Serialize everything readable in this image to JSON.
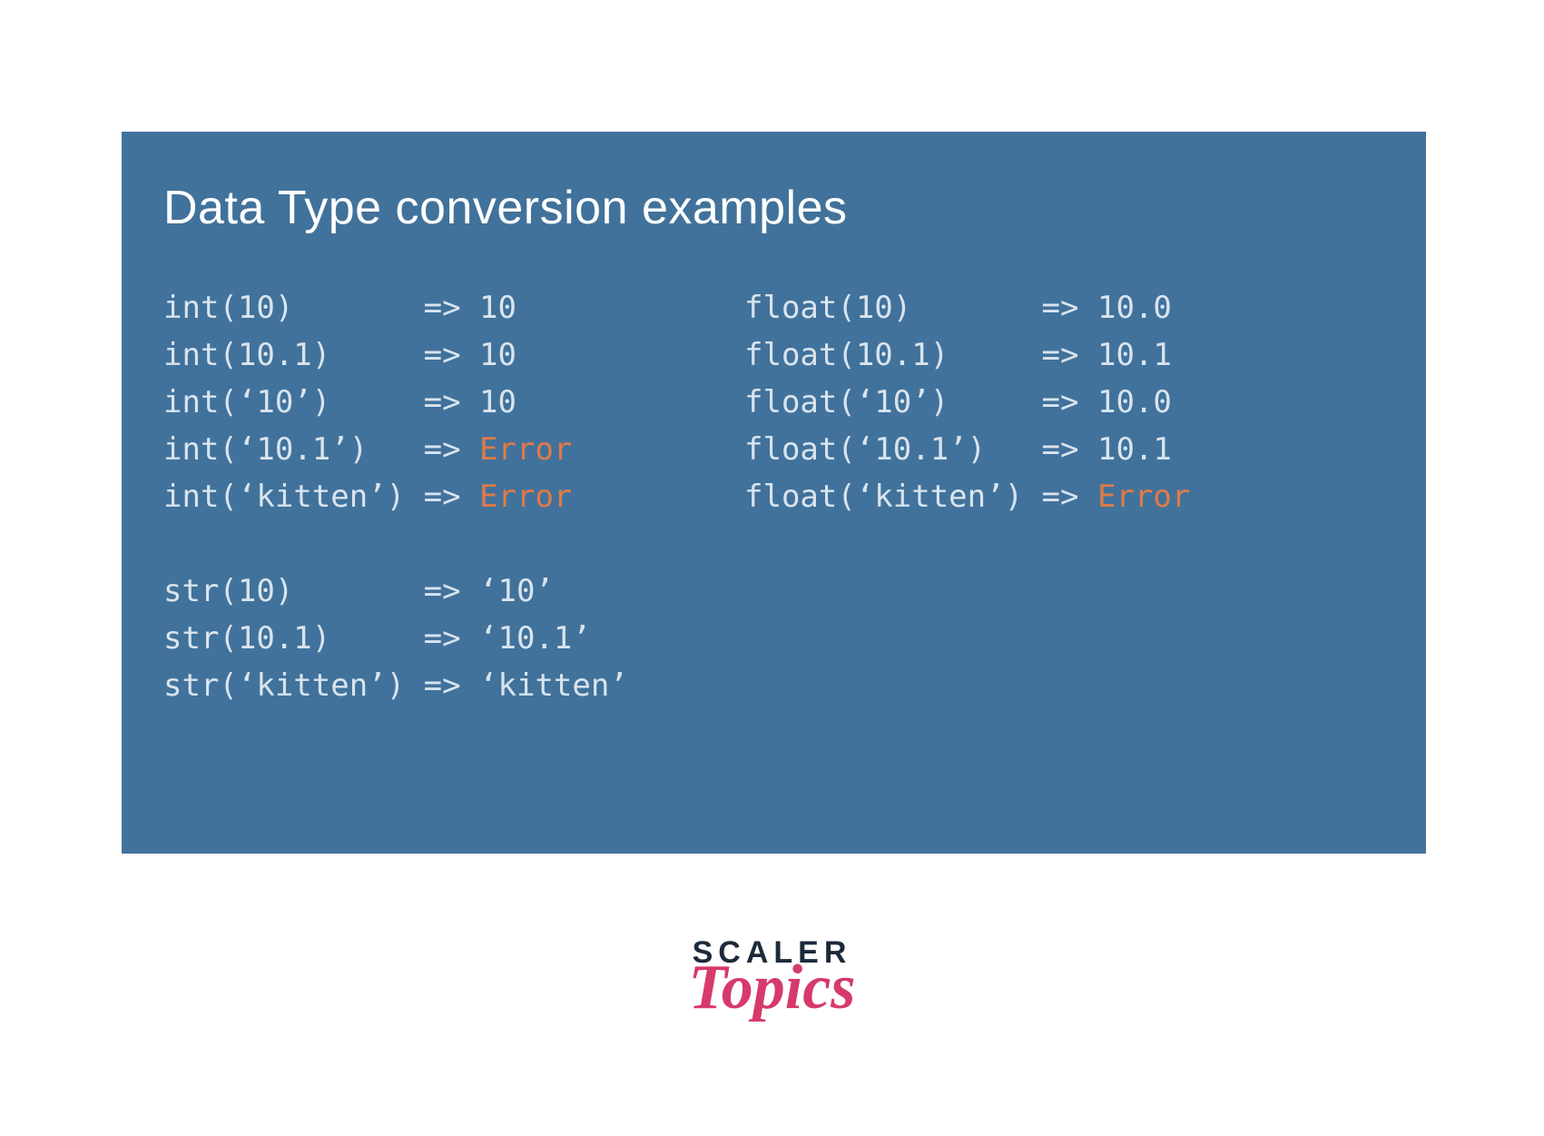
{
  "slide": {
    "title": "Data Type conversion examples",
    "arrow": "=>",
    "left": {
      "int": [
        {
          "expr": "int(10)",
          "pad": "       ",
          "result": "10",
          "error": false
        },
        {
          "expr": "int(10.1)",
          "pad": "     ",
          "result": "10",
          "error": false
        },
        {
          "expr": "int(‘10’)",
          "pad": "     ",
          "result": "10",
          "error": false
        },
        {
          "expr": "int(‘10.1’)",
          "pad": "   ",
          "result": "Error",
          "error": true
        },
        {
          "expr": "int(‘kitten’)",
          "pad": " ",
          "result": "Error",
          "error": true
        }
      ],
      "str": [
        {
          "expr": "str(10)",
          "pad": "       ",
          "result": "‘10’",
          "error": false
        },
        {
          "expr": "str(10.1)",
          "pad": "     ",
          "result": "‘10.1’",
          "error": false
        },
        {
          "expr": "str(‘kitten’)",
          "pad": " ",
          "result": "‘kitten’",
          "error": false
        }
      ]
    },
    "right": {
      "float": [
        {
          "expr": "float(10)",
          "pad": "       ",
          "result": "10.0",
          "error": false
        },
        {
          "expr": "float(10.1)",
          "pad": "     ",
          "result": "10.1",
          "error": false
        },
        {
          "expr": "float(‘10’)",
          "pad": "     ",
          "result": "10.0",
          "error": false
        },
        {
          "expr": "float(‘10.1’)",
          "pad": "   ",
          "result": "10.1",
          "error": false
        },
        {
          "expr": "float(‘kitten’)",
          "pad": " ",
          "result": "Error",
          "error": true
        }
      ]
    }
  },
  "logo": {
    "line1": "SCALER",
    "line2": "Topics"
  }
}
